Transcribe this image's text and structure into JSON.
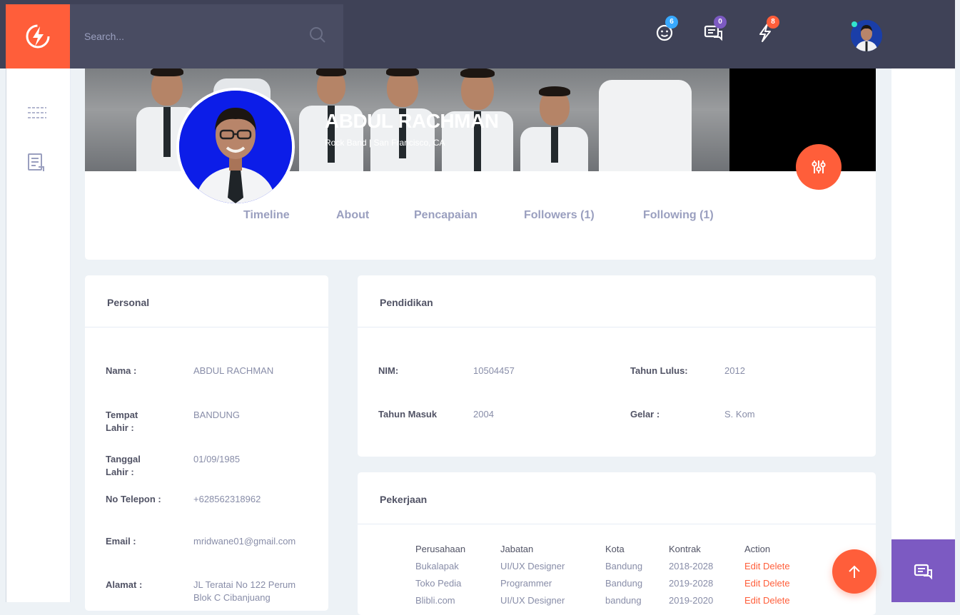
{
  "search": {
    "placeholder": "Search..."
  },
  "topbar": {
    "badges": {
      "friends": "6",
      "messages": "0",
      "notifications": "8"
    },
    "badge_colors": {
      "friends": "#38a9ff",
      "messages": "#7c5ac2",
      "notifications": "#ff5e3a"
    }
  },
  "profile": {
    "name": "ABDUL RACHMAN",
    "subtitle": "Rock Band | San Francisco, CA"
  },
  "tabs": [
    "Timeline",
    "About",
    "Pencapaian",
    "Followers (1)",
    "Following (1)"
  ],
  "personal": {
    "title": "Personal",
    "rows": [
      {
        "label": "Nama :",
        "value": "ABDUL RACHMAN"
      },
      {
        "label": "Tempat Lahir :",
        "value": "BANDUNG"
      },
      {
        "label": "Tanggal Lahir :",
        "value": "01/09/1985"
      },
      {
        "label": "No Telepon :",
        "value": "+628562318962"
      },
      {
        "label": "Email :",
        "value": "mridwane01@gmail.com"
      },
      {
        "label": "Alamat :",
        "value": "JL Teratai No 122 Perum Blok C Cibanjuang"
      }
    ]
  },
  "pendidikan": {
    "title": "Pendidikan",
    "nim_label": "NIM:",
    "nim": "10504457",
    "lulus_label": "Tahun Lulus:",
    "lulus": "2012",
    "masuk_label": "Tahun Masuk",
    "masuk": "2004",
    "gelar_label": "Gelar :",
    "gelar": "S. Kom"
  },
  "pekerjaan": {
    "title": "Pekerjaan",
    "headers": [
      "Perusahaan",
      "Jabatan",
      "Kota",
      "Kontrak",
      "Action"
    ],
    "rows": [
      {
        "perusahaan": "Bukalapak",
        "jabatan": "UI/UX Designer",
        "kota": "Bandung",
        "kontrak": "2018-2028",
        "action": "Edit Delete"
      },
      {
        "perusahaan": "Toko Pedia",
        "jabatan": "Programmer",
        "kota": "Bandung",
        "kontrak": "2019-2028",
        "action": "Edit Delete"
      },
      {
        "perusahaan": "Blibli.com",
        "jabatan": "UI/UX Designer",
        "kota": "bandung",
        "kontrak": "2019-2020",
        "action": "Edit Delete"
      }
    ]
  },
  "icons": {
    "logo": "lightning-logo-icon",
    "search": "search-icon",
    "friends": "smiley-icon",
    "messages": "chat-icon",
    "notifications": "lightning-icon",
    "menu": "menu-lines-icon",
    "newsfeed": "newsfeed-icon",
    "settings": "sliders-icon",
    "scroll_top": "arrow-up-icon",
    "chat": "chat-bubble-icon"
  },
  "colors": {
    "accent": "#ff5e3a",
    "header": "#3f4257",
    "purple": "#7c5ac2"
  }
}
